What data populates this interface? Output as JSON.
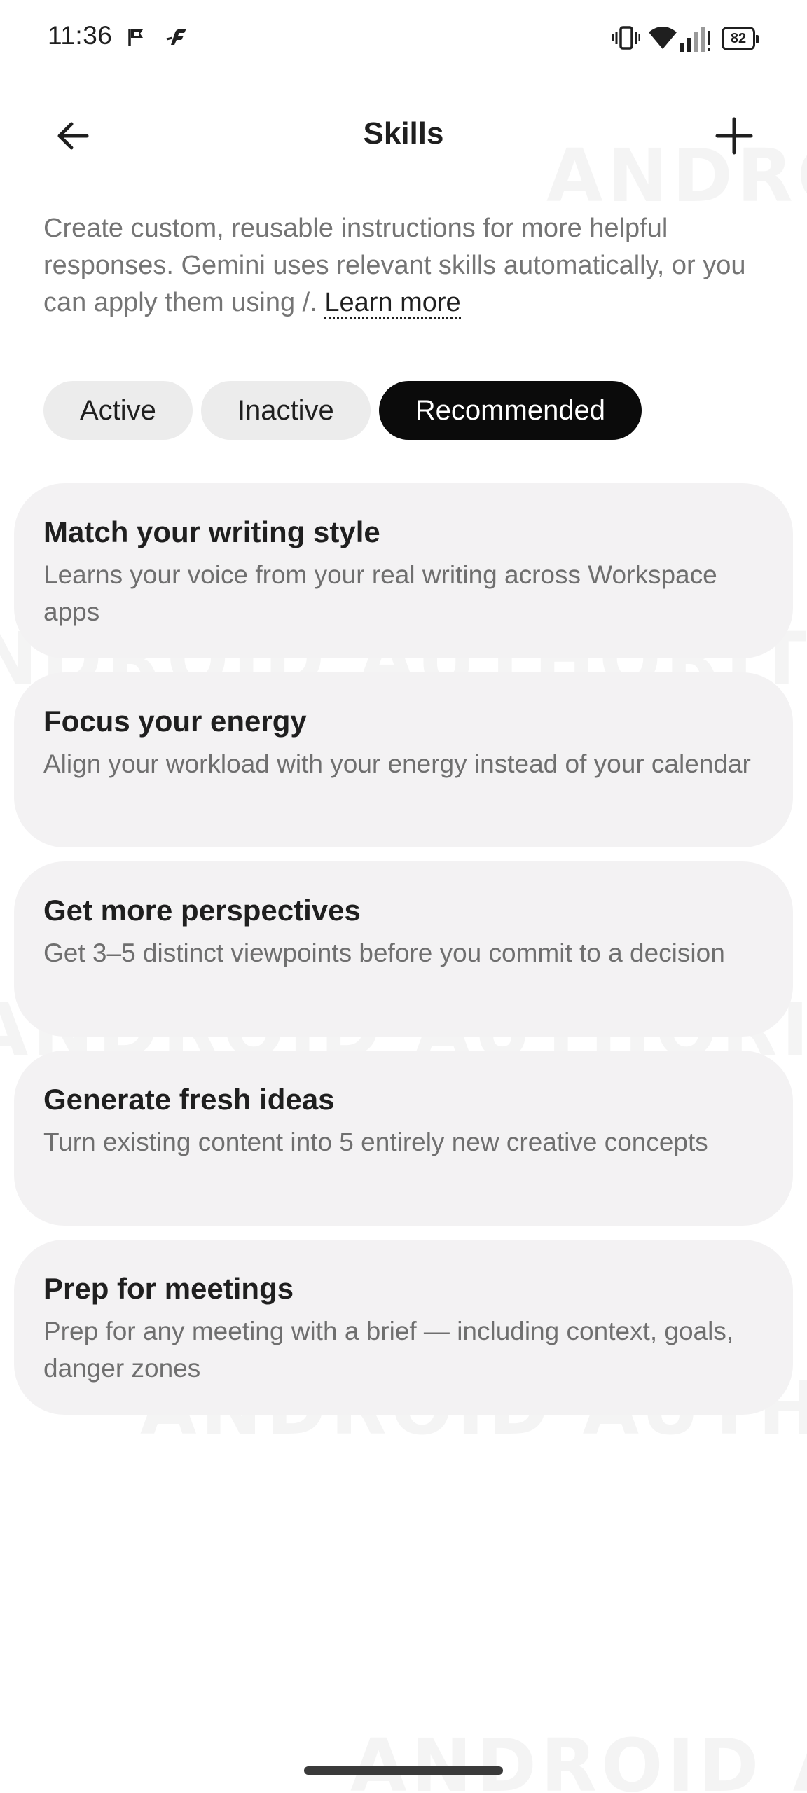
{
  "status_bar": {
    "time": "11:36",
    "battery_level": "82",
    "icons": [
      "flag-notification-icon",
      "app-notification-icon",
      "vibrate-icon",
      "wifi-icon",
      "cell-signal-icon",
      "battery-icon"
    ]
  },
  "app_bar": {
    "title": "Skills",
    "back_icon": "arrow-back-icon",
    "add_icon": "plus-icon"
  },
  "description": {
    "text": "Create custom, reusable instructions for more helpful responses. Gemini uses relevant skills automatically, or you can apply them using /. ",
    "link_label": "Learn more"
  },
  "tabs": [
    {
      "label": "Active",
      "selected": false
    },
    {
      "label": "Inactive",
      "selected": false
    },
    {
      "label": "Recommended",
      "selected": true
    }
  ],
  "skills": [
    {
      "title": "Match your writing style",
      "description": "Learns your voice from your real writing across Workspace apps"
    },
    {
      "title": "Focus your energy",
      "description": "Align your workload with your energy instead of your calendar"
    },
    {
      "title": "Get more perspectives",
      "description": "Get 3–5 distinct viewpoints before you commit to a decision"
    },
    {
      "title": "Generate fresh ideas",
      "description": "Turn existing content into 5 entirely new creative concepts"
    },
    {
      "title": "Prep for meetings",
      "description": "Prep for any meeting with a brief — including context, goals, danger zones"
    }
  ],
  "watermark": "ANDROID AUTHORITY",
  "colors": {
    "selected_chip": "#0b0b0b",
    "chip": "#ececec",
    "card": "#f3f2f3",
    "secondary_text": "#757575"
  }
}
